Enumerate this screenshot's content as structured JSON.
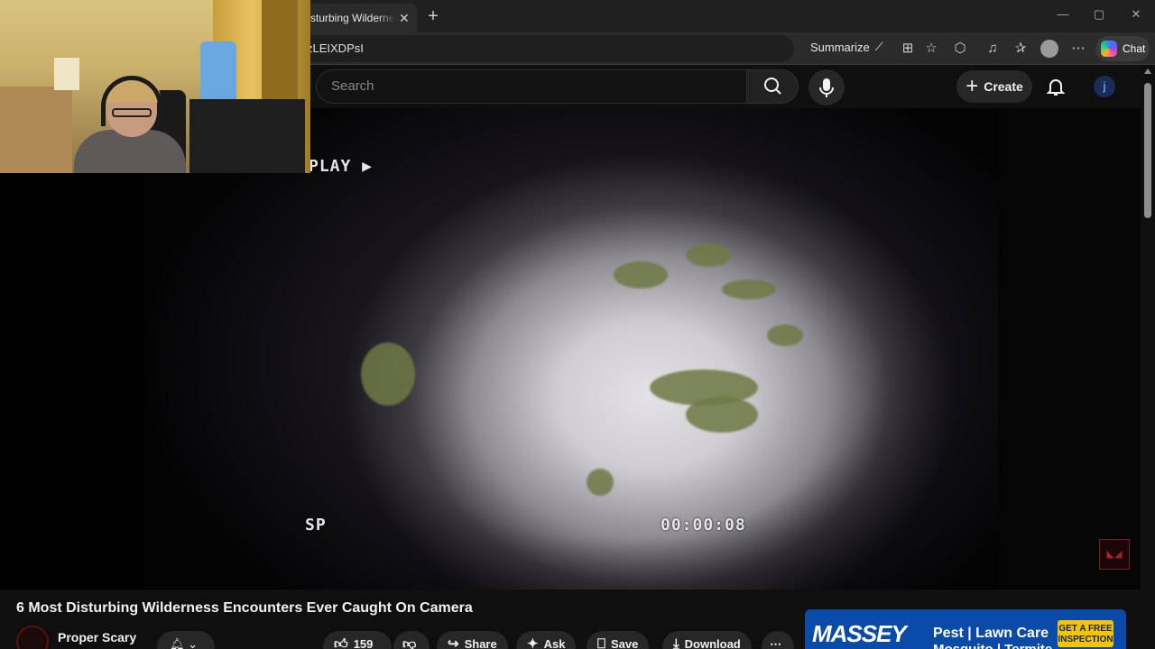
{
  "browser": {
    "tab_title": "sturbing Wilderness",
    "tab_close": "✕",
    "new_tab": "+",
    "address_text": "zLEIXDPsI",
    "summarize_label": "Summarize",
    "chat_label": "Chat",
    "window_controls": [
      "—",
      "▢",
      "✕"
    ]
  },
  "youtube": {
    "search_placeholder": "Search",
    "create_label": "Create",
    "user_initial": "j"
  },
  "video": {
    "osd_play": "PLAY ▶",
    "osd_mode": "SP",
    "osd_time": "00:00:08",
    "title": "6 Most Disturbing Wilderness Encounters Ever Caught On Camera"
  },
  "channel": {
    "name": "Proper Scary",
    "bell_caret": "⌄"
  },
  "actions": {
    "likes": "159",
    "share": "Share",
    "ask": "Ask",
    "save": "Save",
    "download": "Download",
    "more": "⋯"
  },
  "ad": {
    "brand": "MASSEY",
    "line1": "Pest | Lawn Care",
    "line2": "Mosquito | Termite",
    "cta": "GET A FREE INSPECTION"
  },
  "colors": {
    "accent": "#ff0000",
    "background": "#0f0f0f",
    "ad_blue": "#0a4aa8",
    "ad_yellow": "#f6c400"
  }
}
